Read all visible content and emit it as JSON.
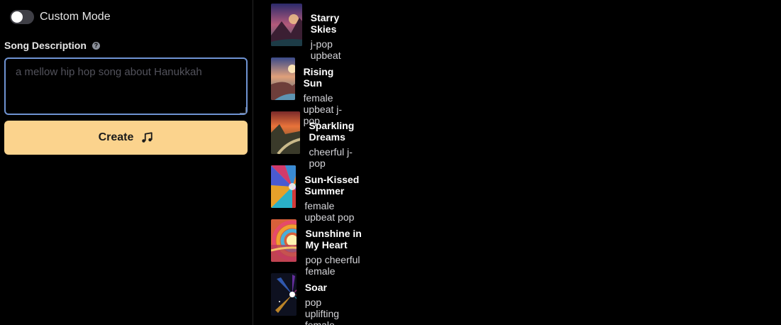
{
  "custom_mode": {
    "label": "Custom Mode",
    "enabled": false
  },
  "description": {
    "label": "Song Description",
    "help_icon": "question-circle-icon",
    "placeholder": "a mellow hip hop song about Hanukkah",
    "value": ""
  },
  "create_button": {
    "label": "Create",
    "icon": "music-note-icon"
  },
  "colors": {
    "accent": "#fbd38d",
    "input_border": "#6f93d2",
    "background": "#000000"
  },
  "songs": [
    {
      "title": "Starry Skies",
      "tags": "j-pop upbeat"
    },
    {
      "title": "Rising Sun",
      "tags": "female upbeat j-pop"
    },
    {
      "title": "Sparkling Dreams",
      "tags": "cheerful j-pop"
    },
    {
      "title": "Sun-Kissed Summer",
      "tags": "female upbeat pop"
    },
    {
      "title": "Sunshine in My Heart",
      "tags": "pop cheerful female"
    },
    {
      "title": "Soar",
      "tags": "pop uplifting female"
    }
  ]
}
